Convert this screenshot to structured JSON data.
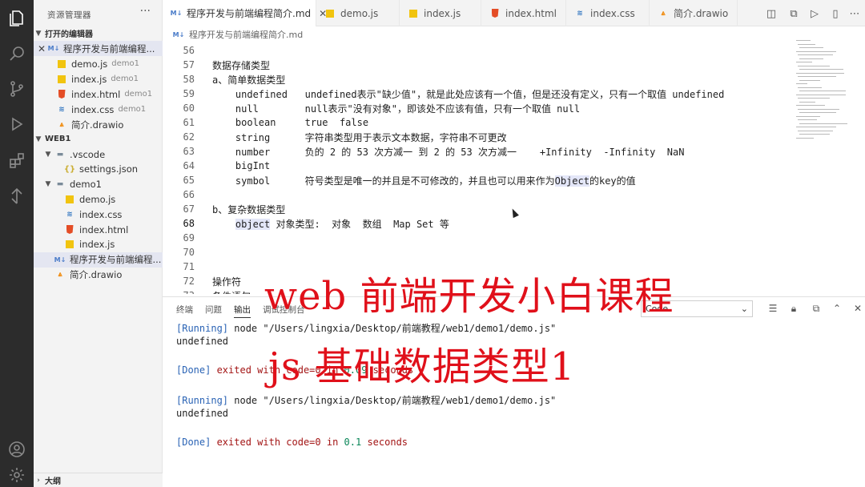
{
  "sidebar": {
    "title": "资源管理器",
    "more": "···",
    "open_editors_label": "打开的编辑器",
    "open_editors": [
      {
        "name": "程序开发与前端编程...",
        "type": "md",
        "desc": "",
        "selected": true,
        "close": "✕"
      },
      {
        "name": "demo.js",
        "type": "js",
        "desc": "demo1"
      },
      {
        "name": "index.js",
        "type": "js",
        "desc": "demo1"
      },
      {
        "name": "index.html",
        "type": "html",
        "desc": "demo1"
      },
      {
        "name": "index.css",
        "type": "css",
        "desc": "demo1"
      },
      {
        "name": "简介.drawio",
        "type": "drawio",
        "desc": ""
      }
    ],
    "workspace_label": "WEB1",
    "tree": [
      {
        "name": ".vscode",
        "type": "folder",
        "indent": 1
      },
      {
        "name": "settings.json",
        "type": "json",
        "indent": 2
      },
      {
        "name": "demo1",
        "type": "folder",
        "indent": 1
      },
      {
        "name": "demo.js",
        "type": "js",
        "indent": 2
      },
      {
        "name": "index.css",
        "type": "css",
        "indent": 2
      },
      {
        "name": "index.html",
        "type": "html",
        "indent": 2
      },
      {
        "name": "index.js",
        "type": "js",
        "indent": 2
      },
      {
        "name": "程序开发与前端编程...",
        "type": "md",
        "indent": 1,
        "selected": true
      },
      {
        "name": "简介.drawio",
        "type": "drawio",
        "indent": 1
      }
    ],
    "outline_label": "大纲"
  },
  "tabs": [
    {
      "label": "程序开发与前端编程简介.md",
      "type": "md",
      "active": true,
      "close": "✕"
    },
    {
      "label": "demo.js",
      "type": "js"
    },
    {
      "label": "index.js",
      "type": "js"
    },
    {
      "label": "index.html",
      "type": "html"
    },
    {
      "label": "index.css",
      "type": "css"
    },
    {
      "label": "简介.drawio",
      "type": "drawio"
    }
  ],
  "breadcrumb": "程序开发与前端编程简介.md",
  "editor": {
    "current_line": 68,
    "lines": [
      {
        "n": "56",
        "text": ""
      },
      {
        "n": "57",
        "text": "数据存储类型"
      },
      {
        "n": "58",
        "text": "a、简单数据类型"
      },
      {
        "n": "59",
        "text": "    undefined   undefined表示\"缺少值\"，就是此处应该有一个值，但是还没有定义，只有一个取值 undefined"
      },
      {
        "n": "60",
        "text": "    null        null表示\"没有对象\"，即该处不应该有值，只有一个取值 null"
      },
      {
        "n": "61",
        "text": "    boolean     true  false"
      },
      {
        "n": "62",
        "text": "    string      字符串类型用于表示文本数据，字符串不可更改"
      },
      {
        "n": "63",
        "text": "    number      负的 2 的 53 次方减一 到 2 的 53 次方减一    +Infinity  -Infinity  NaN"
      },
      {
        "n": "64",
        "text": "    bigInt"
      },
      {
        "n": "65",
        "text": "    symbol      符号类型是唯一的并且是不可修改的，并且也可以用来作为Object的key的值"
      },
      {
        "n": "66",
        "text": ""
      },
      {
        "n": "67",
        "text": "b、复杂数据类型"
      },
      {
        "n": "68",
        "text": "    object 对象类型:  对象  数组  Map Set 等"
      },
      {
        "n": "69",
        "text": ""
      },
      {
        "n": "70",
        "text": ""
      },
      {
        "n": "71",
        "text": ""
      },
      {
        "n": "72",
        "text": "操作符"
      },
      {
        "n": "73",
        "text": "条件语句"
      }
    ]
  },
  "panel": {
    "tabs": [
      "终端",
      "问题",
      "输出",
      "调试控制台"
    ],
    "active_tab": "输出",
    "select_value": "Code",
    "select_arrow": "⌄",
    "output": [
      {
        "type": "running",
        "tag": "[Running]",
        "cmd": " node \"/Users/lingxia/Desktop/前端教程/web1/demo1/demo.js\""
      },
      {
        "type": "plain",
        "text": "undefined"
      },
      {
        "type": "blank"
      },
      {
        "type": "done",
        "tag": "[Done]",
        "pre": " exited with ",
        "code": "code=0",
        "mid": " in ",
        "time": "0.09",
        "post": " seconds"
      },
      {
        "type": "blank"
      },
      {
        "type": "running",
        "tag": "[Running]",
        "cmd": " node \"/Users/lingxia/Desktop/前端教程/web1/demo1/demo.js\""
      },
      {
        "type": "plain",
        "text": "undefined"
      },
      {
        "type": "blank"
      },
      {
        "type": "done",
        "tag": "[Done]",
        "pre": " exited with ",
        "code": "code=0",
        "mid": " in ",
        "time": "0.1",
        "post": " seconds"
      }
    ]
  },
  "overlay": {
    "line1": "web 前端开发小白课程",
    "line2": "js 基础数据类型1",
    "color": "#e0101a"
  },
  "icons": {
    "activity": [
      "files-icon",
      "search-icon",
      "source-control-icon",
      "run-debug-icon",
      "extensions-icon",
      "remote-icon",
      "account-icon",
      "settings-gear-icon"
    ]
  }
}
